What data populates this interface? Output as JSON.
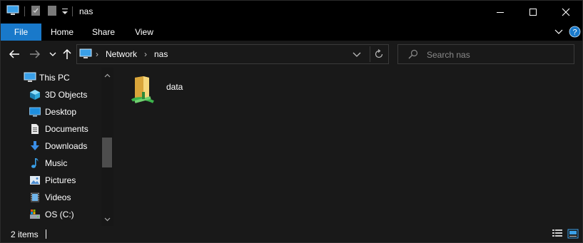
{
  "window": {
    "title": "nas"
  },
  "ribbon": {
    "tabs": [
      {
        "label": "File"
      },
      {
        "label": "Home"
      },
      {
        "label": "Share"
      },
      {
        "label": "View"
      }
    ]
  },
  "address": {
    "breadcrumbs": [
      {
        "label": "Network"
      },
      {
        "label": "nas"
      }
    ]
  },
  "search": {
    "placeholder": "Search nas"
  },
  "navpane": {
    "items": [
      {
        "label": "This PC",
        "icon": "this-pc-icon"
      },
      {
        "label": "3D Objects",
        "icon": "3d-objects-icon"
      },
      {
        "label": "Desktop",
        "icon": "desktop-icon"
      },
      {
        "label": "Documents",
        "icon": "documents-icon"
      },
      {
        "label": "Downloads",
        "icon": "downloads-icon"
      },
      {
        "label": "Music",
        "icon": "music-icon"
      },
      {
        "label": "Pictures",
        "icon": "pictures-icon"
      },
      {
        "label": "Videos",
        "icon": "videos-icon"
      },
      {
        "label": "OS (C:)",
        "icon": "drive-icon"
      }
    ]
  },
  "content": {
    "items": [
      {
        "label": "data",
        "icon": "network-share-folder-icon"
      }
    ]
  },
  "status": {
    "item_count": "2 items"
  },
  "colors": {
    "accent": "#1979ca",
    "background": "#191919",
    "titlebar": "#000000"
  }
}
